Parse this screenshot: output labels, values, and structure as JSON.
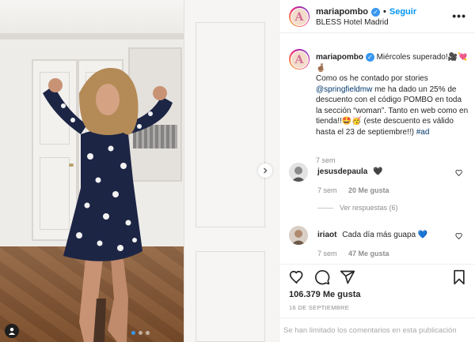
{
  "post": {
    "username": "mariapombo",
    "follow_label": "Seguir",
    "location": "BLESS Hotel Madrid",
    "more_label": "•••"
  },
  "caption": {
    "username": "mariapombo",
    "text_1": "Miércoles superado!🎥💘🤞🏽",
    "text_2": "Como os he contado por stories",
    "mention": "@springfieldmw",
    "text_3": "me ha dado un 25% de descuento con el código POMBO en toda la sección “woman”. Tanto en web como en tienda!!🤩🥳 (este descuento es válido hasta el 23 de septiembre!!)",
    "hashtag": "#ad",
    "time": "7 sem"
  },
  "comments": [
    {
      "username": "jesusdepaula",
      "text": "🖤",
      "time": "7 sem",
      "likes": "20 Me gusta"
    },
    {
      "username": "iriaot",
      "text": "Cada día más guapa 💙",
      "time": "7 sem",
      "likes": "47 Me gusta"
    }
  ],
  "replies_label": "Ver respuestas (6)",
  "likes_count": "106.379 Me gusta",
  "date": "16 DE SEPTIEMBRE",
  "comments_limited": "Se han limitado los comentarios en esta publicación",
  "carousel": {
    "slides": 3,
    "active": 1
  },
  "colors": {
    "accent": "#0095f6",
    "verified": "#3897f0",
    "text": "#262626",
    "muted": "#8e8e8e"
  }
}
